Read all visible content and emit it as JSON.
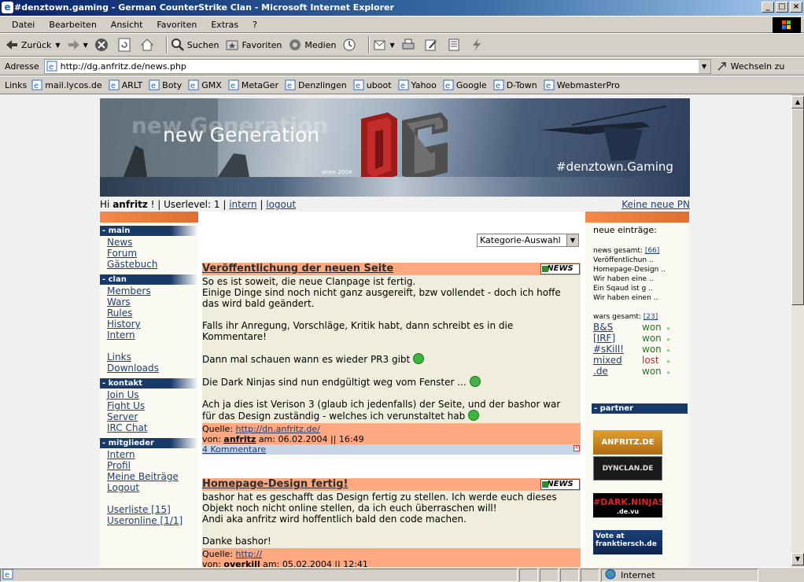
{
  "window": {
    "title": "#denztown.gaming - German CounterStrike Clan - Microsoft Internet Explorer",
    "min": "_",
    "max": "□",
    "close": "×"
  },
  "menu": [
    "Datei",
    "Bearbeiten",
    "Ansicht",
    "Favoriten",
    "Extras",
    "?"
  ],
  "toolbar": {
    "back": "Zurück",
    "search": "Suchen",
    "favorites": "Favoriten",
    "media": "Medien"
  },
  "address": {
    "label": "Adresse",
    "url": "http://dg.anfritz.de/news.php",
    "go": "Wechseln zu"
  },
  "links": {
    "label": "Links",
    "items": [
      "mail.lycos.de",
      "ARLT",
      "Boty",
      "GMX",
      "MetaGer",
      "Denzlingen",
      "uboot",
      "Yahoo",
      "Google",
      "D-Town",
      "WebmasterPro"
    ]
  },
  "banner": {
    "tagline": "new Generation",
    "faint": "new Generation",
    "since": "since 2004",
    "site": "#denztown.Gaming",
    "logo": "DG"
  },
  "user": {
    "hi": "Hi",
    "name": "anfritz",
    "level_text": "! | Userlevel: 1 |",
    "intern": "intern",
    "sep": "|",
    "logout": "logout",
    "pn": "Keine neue PN"
  },
  "nav": {
    "main": {
      "title": "- main",
      "items": [
        "News",
        "Forum",
        "Gästebuch"
      ]
    },
    "clan": {
      "title": "- clan",
      "items": [
        "Members",
        "Wars",
        "Rules",
        "History",
        "Intern",
        "Links",
        "Downloads"
      ]
    },
    "kontakt": {
      "title": "- kontakt",
      "items": [
        "Join Us",
        "Fight Us",
        "Server",
        "IRC Chat"
      ]
    },
    "mitglieder": {
      "title": "- mitglieder",
      "items": [
        "Intern",
        "Profil",
        "Meine Beiträge",
        "Logout",
        "Userliste [15]",
        "Useronline [1/1]"
      ]
    }
  },
  "category": "Kategorie-Auswahl",
  "news": [
    {
      "title": "Veröffentlichung der neuen Seite",
      "badge": "NEWS",
      "p1": "So es ist soweit, die neue Clanpage ist fertig.",
      "p2": "Einige Dinge sind noch nicht ganz ausgereift, bzw vollendet - doch ich hoffe",
      "p3": "das wird bald geändert.",
      "p4": "Falls ihr Anregung, Vorschläge, Kritik habt, dann schreibt es in die",
      "p5": "Kommentare!",
      "p6": "Dann mal schauen wann es wieder PR3 gibt",
      "p7": "Die Dark Ninjas sind nun endgültigt weg vom Fenster ...",
      "p8": "Ach ja dies ist Verison 3 (glaub ich jedenfalls) der Seite, und der bashor war",
      "p9": "für das Design zuständig - welches ich verunstaltet hab",
      "source_label": "Quelle:",
      "source": "http://dn.anfritz.de/",
      "by_label": "von:",
      "author": "anfritz",
      "date": "am: 06.02.2004 || 16:49",
      "comments": "4 Kommentare"
    },
    {
      "title": "Homepage-Design fertig!",
      "badge": "NEWS",
      "p1": "bashor hat es geschafft das Design fertig zu stellen. Ich werde euch dieses",
      "p2": "Objekt noch nicht online stellen, da ich euch überraschen will!",
      "p3": "Andi aka anfritz wird hoffentlich bald den code machen.",
      "p4": "Danke bashor!",
      "source_label": "Quelle:",
      "source": "http://",
      "by_label": "von:",
      "author": "overkill",
      "date": "am: 05.02.2004 || 12:41"
    }
  ],
  "right": {
    "new_entries": "neue einträge:",
    "news_total_label": "news gesamt:",
    "news_total": "[66]",
    "news_items": [
      "Veröffentlichun ..",
      "Homepage-Design ..",
      "Wir haben eine ..",
      "Ein Sqaud ist g ..",
      "Wir haben einen .."
    ],
    "wars_total_label": "wars gesamt:",
    "wars_total": "[23]",
    "wars": [
      {
        "team": "B&S",
        "result": "won"
      },
      {
        "team": "[IRF]",
        "result": "won"
      },
      {
        "team": "#sKill!",
        "result": "won"
      },
      {
        "team": "mixed",
        "result": "lost"
      },
      {
        "team": ".de",
        "result": "won"
      }
    ],
    "partner_title": "- partner",
    "partners": [
      "ANFRITZ.DE",
      "DYNCLAN.DE",
      "#DARK.NINJAS",
      "Vote at franktiersch.de"
    ],
    "partner_sub": [
      ".de.vu"
    ]
  },
  "status": {
    "zone": "Internet"
  }
}
